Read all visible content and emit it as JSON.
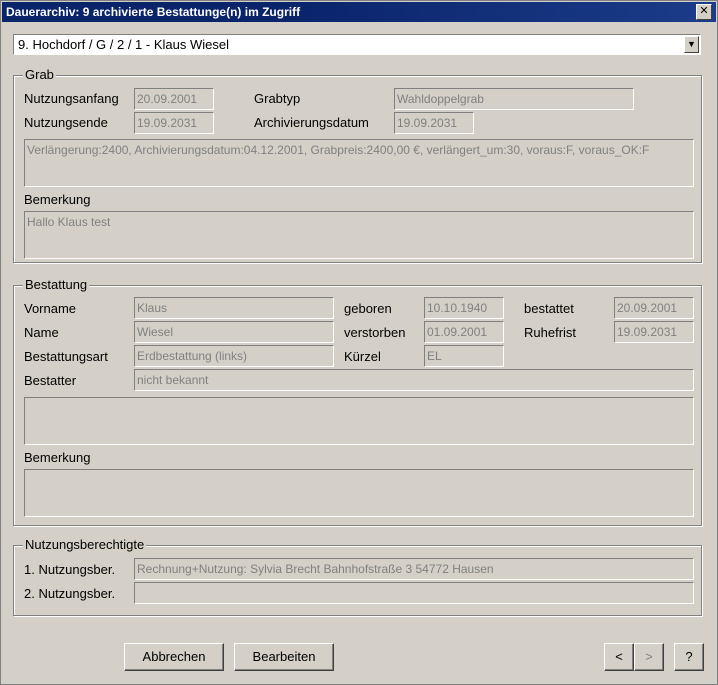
{
  "window": {
    "title": "Dauerarchiv:  9 archivierte Bestattunge(n) im Zugriff",
    "close": "✕"
  },
  "selector": {
    "value": "9. Hochdorf / G / 2 / 1  -  Klaus Wiesel",
    "arrow": "▼"
  },
  "grab": {
    "legend": "Grab",
    "nutzungsanfang_label": "Nutzungsanfang",
    "nutzungsanfang": "20.09.2001",
    "nutzungsende_label": "Nutzungsende",
    "nutzungsende": "19.09.2031",
    "grabtyp_label": "Grabtyp",
    "grabtyp": "Wahldoppelgrab",
    "archivierungsdatum_label": "Archivierungsdatum",
    "archivierungsdatum": "19.09.2031",
    "info": "Verlängerung:2400, Archivierungsdatum:04.12.2001, Grabpreis:2400,00 €, verlängert_um:30, voraus:F, voraus_OK:F",
    "bemerkung_label": "Bemerkung",
    "bemerkung": "Hallo Klaus test"
  },
  "bestattung": {
    "legend": "Bestattung",
    "vorname_label": "Vorname",
    "vorname": "Klaus",
    "name_label": "Name",
    "name": "Wiesel",
    "bestattungsart_label": "Bestattungsart",
    "bestattungsart": "Erdbestattung (links)",
    "bestatter_label": "Bestatter",
    "bestatter": "nicht bekannt",
    "geboren_label": "geboren",
    "geboren": "10.10.1940",
    "verstorben_label": "verstorben",
    "verstorben": "01.09.2001",
    "kuerzel_label": "Kürzel",
    "kuerzel": "EL",
    "bestattet_label": "bestattet",
    "bestattet": "20.09.2001",
    "ruhefrist_label": "Ruhefrist",
    "ruhefrist": "19.09.2031",
    "info": "",
    "bemerkung_label": "Bemerkung",
    "bemerkung": ""
  },
  "nutzungsberechtigte": {
    "legend": "Nutzungsberechtigte",
    "ber1_label": "1. Nutzungsber.",
    "ber1": "Rechnung+Nutzung: Sylvia Brecht Bahnhofstraße 3 54772 Hausen",
    "ber2_label": "2. Nutzungsber.",
    "ber2": ""
  },
  "buttons": {
    "abbrechen": "Abbrechen",
    "bearbeiten": "Bearbeiten",
    "prev": "<",
    "next": ">",
    "help": "?"
  }
}
